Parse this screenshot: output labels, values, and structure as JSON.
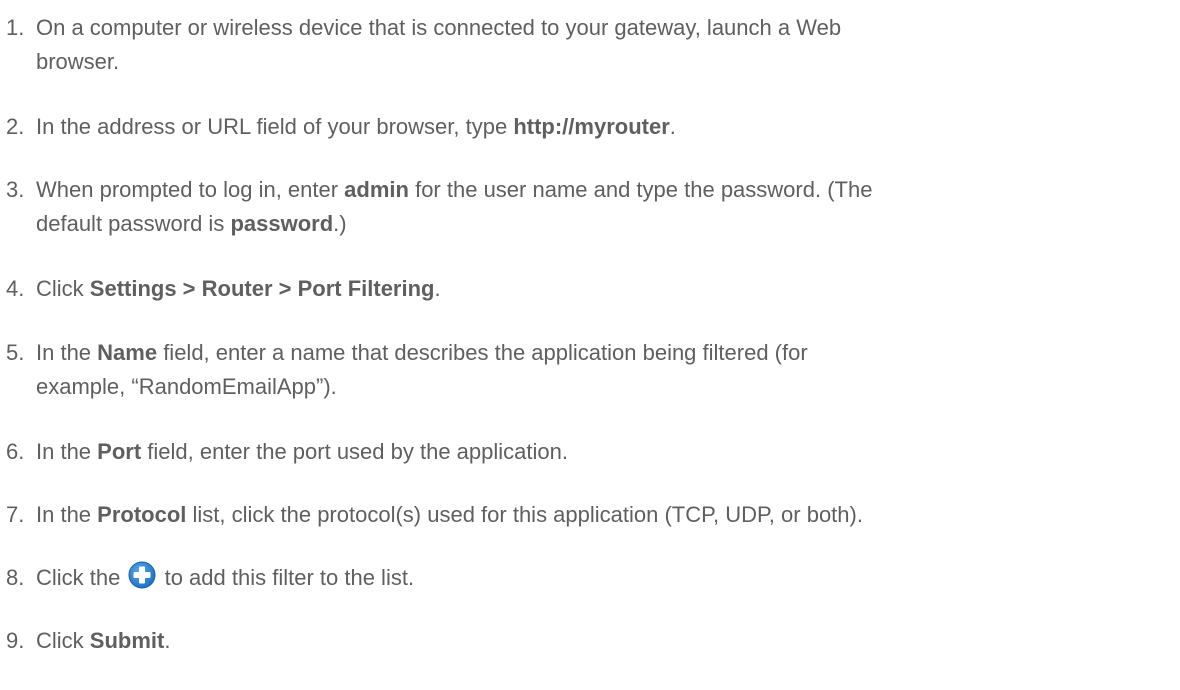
{
  "steps": [
    {
      "num": "1.",
      "t1": "On a computer or wireless device that is connected to your gateway, launch a Web",
      "t2": "browser."
    },
    {
      "num": "2.",
      "t1": "In the address or URL field of your browser, type ",
      "b1": "http://myrouter",
      "t2": "."
    },
    {
      "num": "3.",
      "t1": "When prompted to log in, enter ",
      "b1": "admin",
      "t2": " for the user name and type the password. (The",
      "t3": "default password is ",
      "b2": "password",
      "t4": ".)"
    },
    {
      "num": "4.",
      "t1": "Click ",
      "b1": "Settings > Router > Port Filtering",
      "t2": "."
    },
    {
      "num": "5.",
      "t1": "In the ",
      "b1": "Name",
      "t2": " field, enter a name that describes the application being filtered (for",
      "t3": "example, “RandomEmailApp”)."
    },
    {
      "num": "6.",
      "t1": "In the ",
      "b1": "Port",
      "t2": " field, enter the port used by the application."
    },
    {
      "num": "7.",
      "t1": "In the ",
      "b1": "Protocol",
      "t2": " list, click the protocol(s) used for this application (TCP, UDP, or both)."
    },
    {
      "num": "8.",
      "t1": "Click the ",
      "icon": "add-plus-circle-icon",
      "t2": " to add this filter to the list."
    },
    {
      "num": "9.",
      "t1": "Click ",
      "b1": "Submit",
      "t2": "."
    }
  ],
  "colors": {
    "text": "#5f5f5f",
    "icon_blue": "#1e74c8",
    "icon_blue_light": "#5aa6ea",
    "icon_plus": "#ffffff"
  }
}
